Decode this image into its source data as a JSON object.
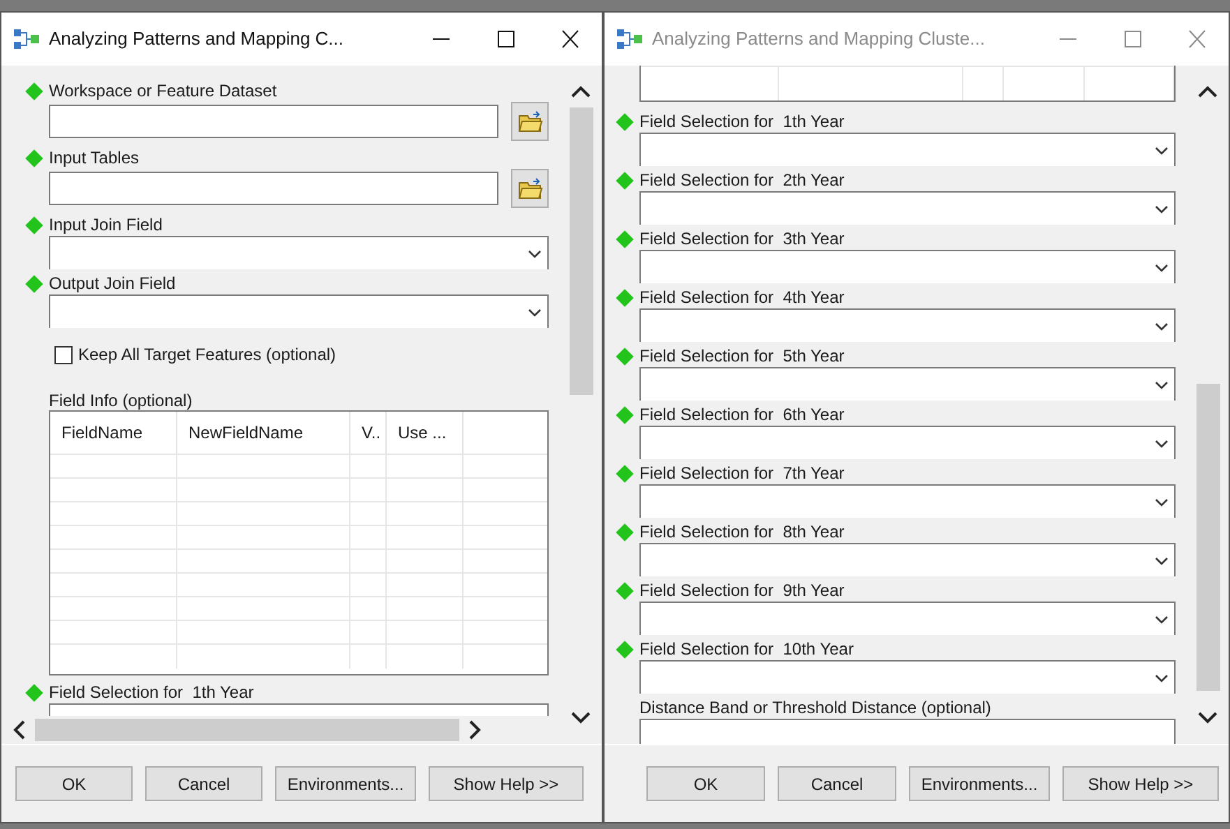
{
  "windows": [
    {
      "title": "Analyzing Patterns and Mapping C...",
      "active": true,
      "hscroll": true,
      "params": [
        {
          "kind": "browse",
          "label": "Workspace or Feature Dataset",
          "required": true
        },
        {
          "kind": "browse",
          "label": "Input Tables",
          "required": true
        },
        {
          "kind": "dropdown",
          "label": "Input Join Field",
          "required": true
        },
        {
          "kind": "dropdown",
          "label": "Output Join Field",
          "required": true
        },
        {
          "kind": "checkbox",
          "label": "Keep All Target Features (optional)",
          "checked": false
        },
        {
          "kind": "table",
          "label": "Field Info (optional)",
          "columns": [
            "FieldName",
            "NewFieldName",
            "V..",
            "Use ..."
          ]
        },
        {
          "kind": "dropdown",
          "label": "Field Selection for  1th Year",
          "required": true
        }
      ],
      "buttons": [
        "OK",
        "Cancel",
        "Environments...",
        "Show Help >>"
      ]
    },
    {
      "title": "Analyzing Patterns and Mapping Cluste...",
      "active": false,
      "hscroll": false,
      "params": [
        {
          "kind": "table_end"
        },
        {
          "kind": "dropdown",
          "label": "Field Selection for  1th Year",
          "required": true
        },
        {
          "kind": "dropdown",
          "label": "Field Selection for  2th Year",
          "required": true
        },
        {
          "kind": "dropdown",
          "label": "Field Selection for  3th Year",
          "required": true
        },
        {
          "kind": "dropdown",
          "label": "Field Selection for  4th Year",
          "required": true
        },
        {
          "kind": "dropdown",
          "label": "Field Selection for  5th Year",
          "required": true
        },
        {
          "kind": "dropdown",
          "label": "Field Selection for  6th Year",
          "required": true
        },
        {
          "kind": "dropdown",
          "label": "Field Selection for  7th Year",
          "required": true
        },
        {
          "kind": "dropdown",
          "label": "Field Selection for  8th Year",
          "required": true
        },
        {
          "kind": "dropdown",
          "label": "Field Selection for  9th Year",
          "required": true
        },
        {
          "kind": "dropdown",
          "label": "Field Selection for  10th Year",
          "required": true
        },
        {
          "kind": "text",
          "label": "Distance Band or Threshold Distance (optional)",
          "required": false
        }
      ],
      "buttons": [
        "OK",
        "Cancel",
        "Environments...",
        "Show Help >>"
      ]
    }
  ]
}
